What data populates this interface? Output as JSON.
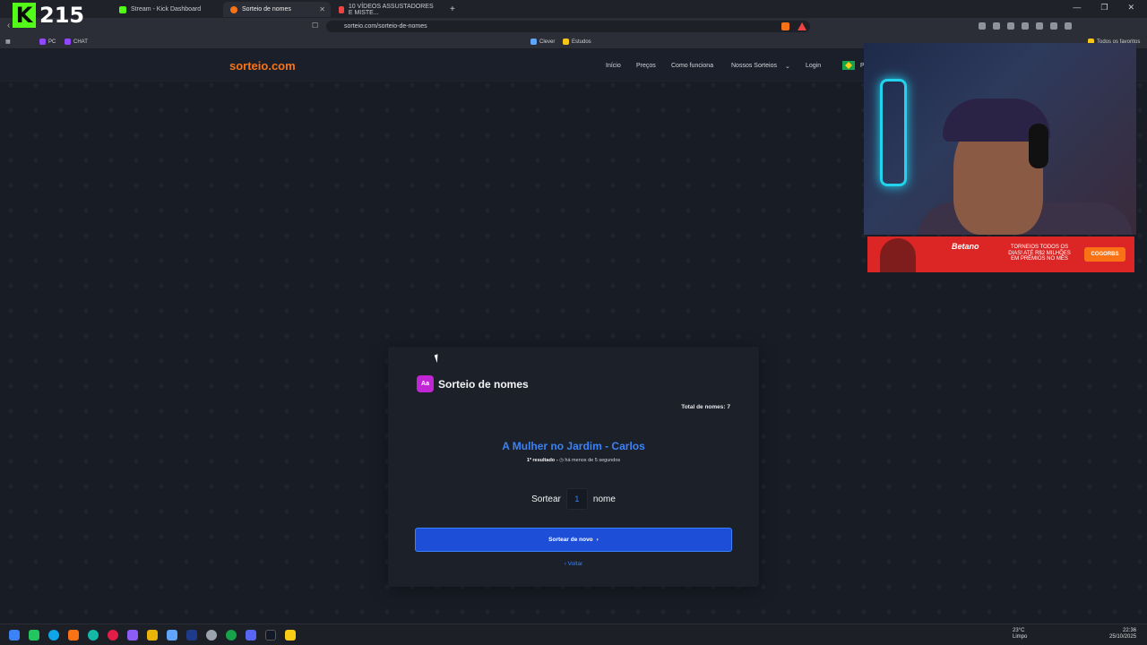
{
  "stream_overlay": {
    "viewer_count": "215",
    "logo": "K"
  },
  "tabs": [
    {
      "label": "Stream - Kick Dashboard",
      "color": "#53fc18"
    },
    {
      "label": "Sorteio de nomes",
      "color": "#f97316"
    },
    {
      "label": "10 VÍDEOS ASSUSTADORES E MISTE...",
      "color": "#ef4444"
    }
  ],
  "browser": {
    "url": "sorteio.com/sorteio-de-nomes",
    "all_favorites": "Todos os favoritos"
  },
  "bookmarks": [
    {
      "label": "PC",
      "color": "#9146ff"
    },
    {
      "label": "CHAT",
      "color": "#9146ff"
    },
    {
      "label": "Clever",
      "color": "#60a5fa"
    },
    {
      "label": "Estudos",
      "color": "#f5c518"
    }
  ],
  "site": {
    "brand": "sorteio.com",
    "nav": [
      "Início",
      "Preços",
      "Como funciona",
      "Nossos Sorteios",
      "Login"
    ],
    "lang_partial": "P"
  },
  "draw": {
    "icon_text": "Aa",
    "title": "Sorteio de nomes",
    "total_label": "Total de nomes: 7",
    "result": "A Mulher no Jardim - Carlos",
    "result_position": "1º resultado -",
    "result_time": "há menos de 5 segundos",
    "sort_label": "Sortear",
    "quantity": "1",
    "unit": "nome",
    "redraw_button": "Sortear de novo",
    "back_link": "Voltar"
  },
  "sponsor": {
    "brand": "Betano",
    "headline": "TORNEIOS TODOS OS DIAS! ATÉ R$2 MILHÕES EM PRÊMIOS NO MÊS",
    "code": "COGORBS"
  },
  "taskbar": {
    "temperature": "23°C",
    "weather": "Limpo",
    "time": "22:36",
    "date": "25/10/2025"
  },
  "colors": {
    "accent_orange": "#f97316",
    "accent_blue": "#3b82f6",
    "button_blue": "#1d4ed8",
    "icon_magenta": "#c026d3",
    "page_bg": "#181c25"
  }
}
